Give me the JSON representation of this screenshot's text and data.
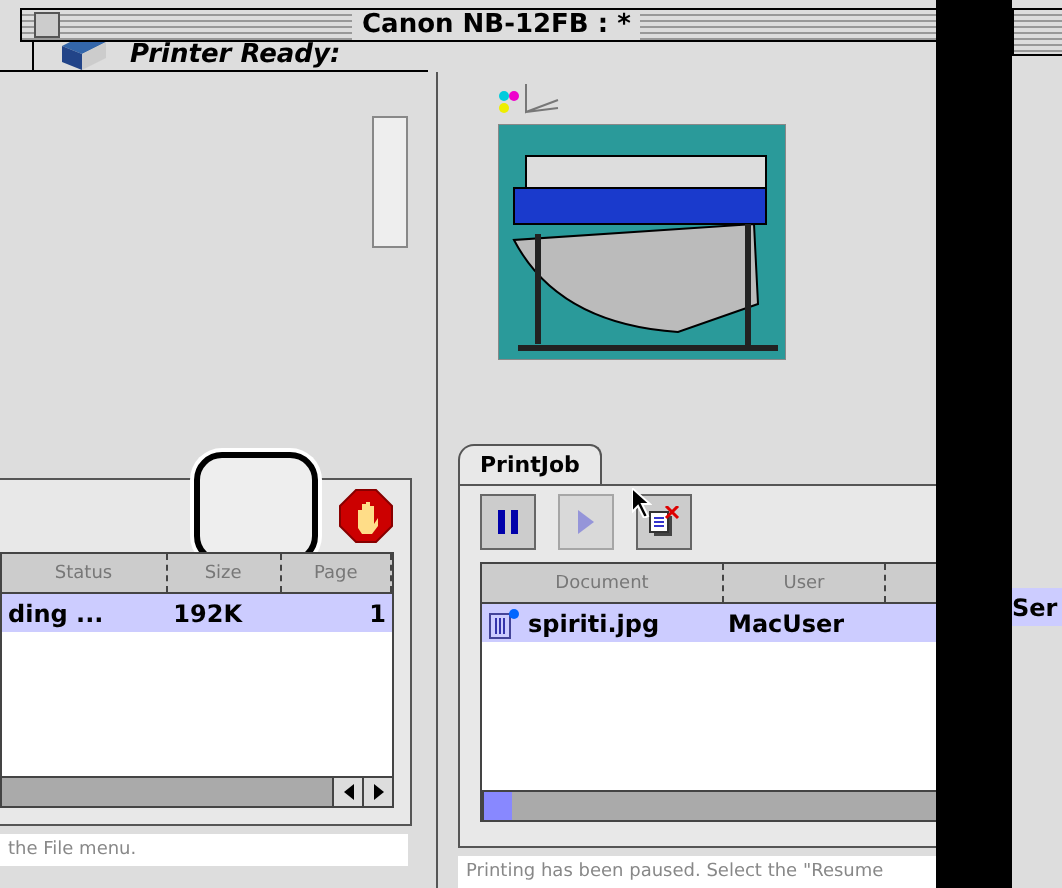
{
  "window": {
    "title": "Canon NB-12FB : *",
    "status": "Printer Ready:"
  },
  "queue_panel": {
    "columns": [
      "Status",
      "Size",
      "Page"
    ],
    "rows": [
      {
        "status": "ding ...",
        "size": "192K",
        "page": "1",
        "selected": true
      }
    ],
    "status_text": "the File menu."
  },
  "printjob_panel": {
    "tab": {
      "label": "PrintJob",
      "selected": true
    },
    "toolbar": [
      {
        "kind": "pause",
        "disabled": false
      },
      {
        "kind": "resume",
        "disabled": true
      },
      {
        "kind": "delete",
        "disabled": false
      }
    ],
    "columns": [
      "Document",
      "User"
    ],
    "rows": [
      {
        "document": "spiriti.jpg",
        "user": "MacUser",
        "selected": true
      }
    ],
    "status_text": "Printing has been paused. Select the \"Resume"
  },
  "side_window": {
    "cell": "Ser"
  }
}
